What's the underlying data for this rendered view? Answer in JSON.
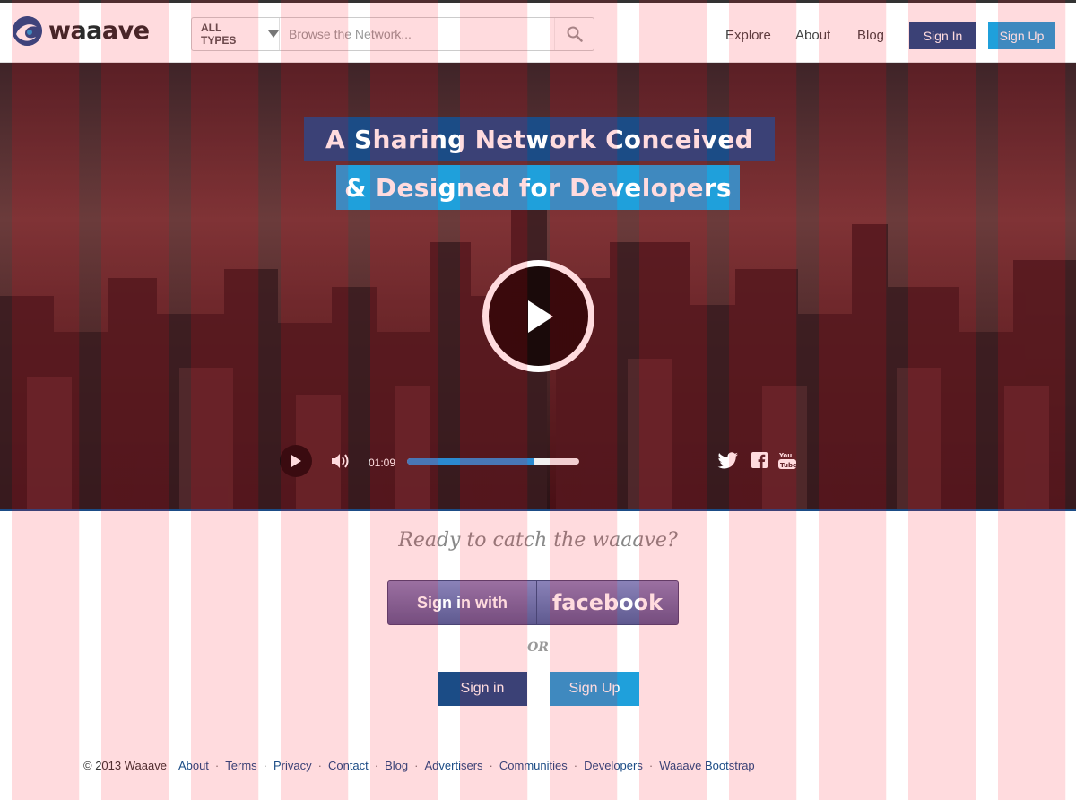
{
  "header": {
    "logo_text": "waaave",
    "search": {
      "type_label": "ALL TYPES",
      "placeholder": "Browse the Network..."
    },
    "nav": {
      "explore": "Explore",
      "about": "About",
      "blog": "Blog"
    },
    "sign_in": "Sign In",
    "sign_up": "Sign Up"
  },
  "hero": {
    "headline_line1": "A Sharing Network Conceived",
    "headline_line2": "& Designed for Developers",
    "player": {
      "time": "01:09",
      "progress": 0.74
    }
  },
  "cta": {
    "tagline": "Ready to catch the waaave?",
    "facebook_prefix": "Sign in with",
    "facebook_brand": "facebook",
    "or": "OR",
    "sign_in": "Sign in",
    "sign_up": "Sign Up"
  },
  "footer": {
    "copyright": "© 2013 Waaave",
    "links": [
      "About",
      "Terms",
      "Privacy",
      "Contact",
      "Blog",
      "Advertisers",
      "Communities",
      "Developers",
      "Waaave Bootstrap"
    ]
  },
  "colors": {
    "primary": "#1b4c86",
    "accent": "#1fa0db"
  }
}
